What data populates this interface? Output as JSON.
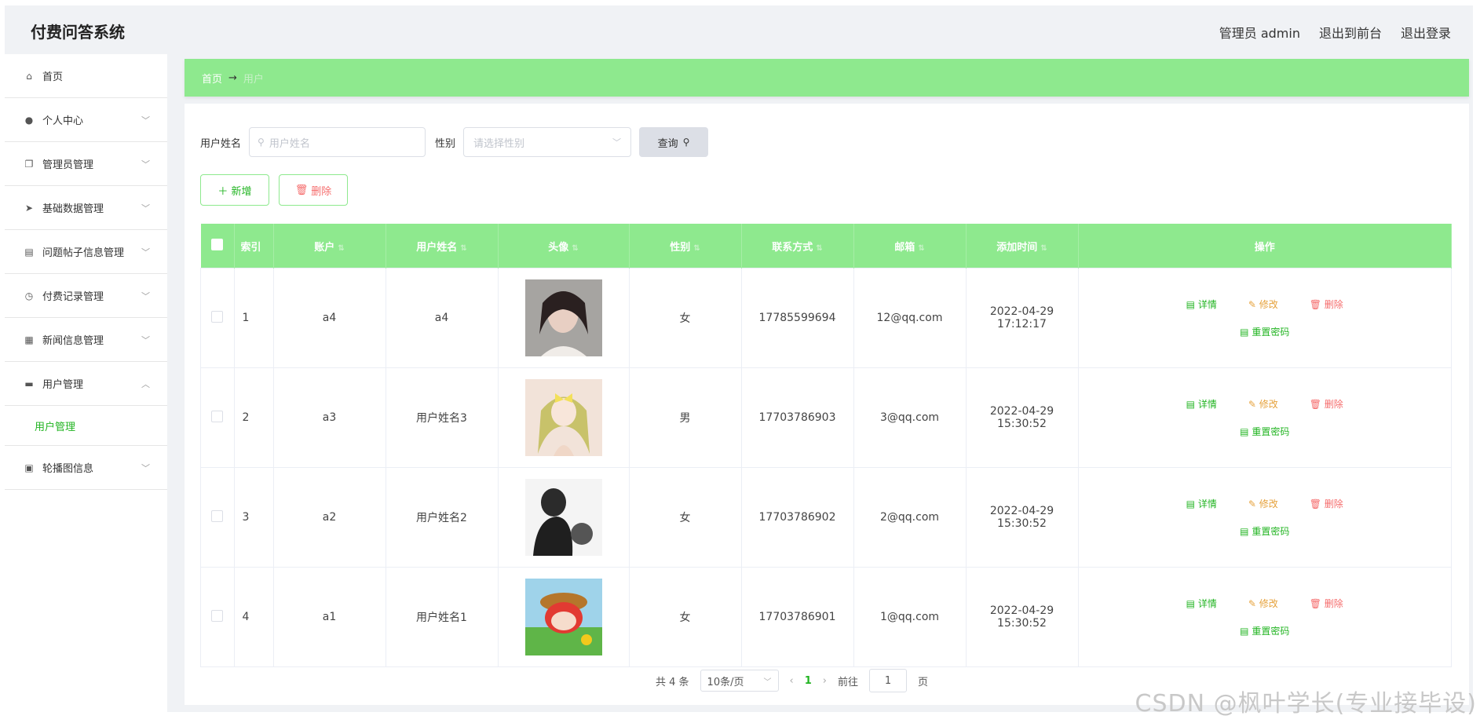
{
  "app": {
    "title": "付费问答系统"
  },
  "header": {
    "user": "管理员 admin",
    "front": "退出到前台",
    "logout": "退出登录"
  },
  "sidebar": {
    "items": [
      {
        "label": "首页",
        "icon": "home-icon"
      },
      {
        "label": "个人中心",
        "icon": "user-icon"
      },
      {
        "label": "管理员管理",
        "icon": "copy-icon"
      },
      {
        "label": "基础数据管理",
        "icon": "send-icon"
      },
      {
        "label": "问题帖子信息管理",
        "icon": "printer-icon"
      },
      {
        "label": "付费记录管理",
        "icon": "clock-icon"
      },
      {
        "label": "新闻信息管理",
        "icon": "grid-icon"
      },
      {
        "label": "用户管理",
        "icon": "user-manage-icon"
      },
      {
        "label": "轮播图信息",
        "icon": "picture-icon"
      }
    ],
    "submenu": {
      "label": "用户管理"
    }
  },
  "breadcrumb": {
    "home": "首页",
    "sep": "→",
    "current": "用户"
  },
  "search": {
    "name_label": "用户姓名",
    "name_placeholder": "用户姓名",
    "gender_label": "性别",
    "gender_placeholder": "请选择性别",
    "query_button": "查询"
  },
  "toolbar": {
    "add_label": "＋ 新增",
    "delete_label": "删除"
  },
  "table": {
    "headers": [
      "索引",
      "账户",
      "用户姓名",
      "头像",
      "性别",
      "联系方式",
      "邮箱",
      "添加时间",
      "操作"
    ],
    "rows": [
      {
        "index": "1",
        "account": "a4",
        "name": "a4",
        "gender": "女",
        "phone": "17785599694",
        "email": "12@qq.com",
        "time": "2022-04-29 17:12:17",
        "avatar_color": "#c9a9a0"
      },
      {
        "index": "2",
        "account": "a3",
        "name": "用户姓名3",
        "gender": "男",
        "phone": "17703786903",
        "email": "3@qq.com",
        "time": "2022-04-29 15:30:52",
        "avatar_color": "#e8d9a6"
      },
      {
        "index": "3",
        "account": "a2",
        "name": "用户姓名2",
        "gender": "女",
        "phone": "17703786902",
        "email": "2@qq.com",
        "time": "2022-04-29 15:30:52",
        "avatar_color": "#5b5b5b"
      },
      {
        "index": "4",
        "account": "a1",
        "name": "用户姓名1",
        "gender": "女",
        "phone": "17703786901",
        "email": "1@qq.com",
        "time": "2022-04-29 15:30:52",
        "avatar_color": "#d9443b"
      }
    ],
    "ops": {
      "detail": "详情",
      "edit": "修改",
      "delete": "删除",
      "reset": "重置密码"
    }
  },
  "pager": {
    "total": "共 4 条",
    "size": "10条/页",
    "page": "1",
    "goto": "前往",
    "goto_value": "1",
    "page_unit": "页"
  },
  "watermark": "CSDN @枫叶学长(专业接毕设)",
  "colors": {
    "accent": "#8ee98e",
    "green_text": "#22b422",
    "edit": "#e6a23c",
    "danger": "#f56c6c"
  }
}
